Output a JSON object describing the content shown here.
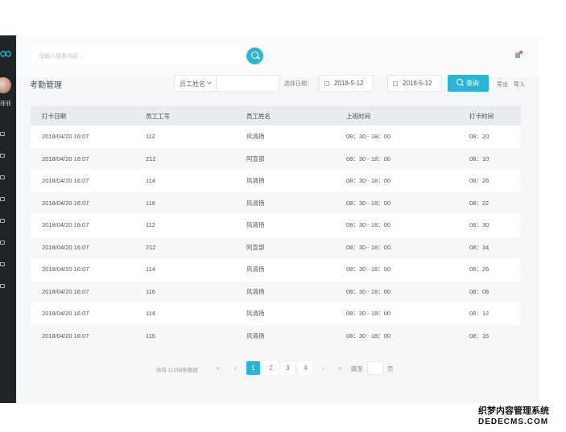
{
  "colors": {
    "accent": "#27b6d8",
    "sidebar": "#1f2428",
    "panel": "#f4f6f8"
  },
  "sidebar": {
    "logo_icon": "infinity-logo-icon",
    "user_name": "菲菲",
    "nav_icons": [
      "user-icon",
      "team-icon",
      "calendar-icon",
      "card-icon",
      "monitor-icon",
      "people-icon",
      "chart-icon",
      "file-icon"
    ]
  },
  "search": {
    "placeholder": "请输入搜索内容..."
  },
  "page": {
    "title": "考勤管理"
  },
  "filters": {
    "field_select": "员工姓名",
    "date_label": "选择日期：",
    "date_start": "2018-5-12",
    "date_end": "2018-5-12",
    "query_label": "查询",
    "export_label": "导出",
    "import_label": "导入"
  },
  "table": {
    "headers": [
      "打卡日期",
      "员工工号",
      "员工姓名",
      "上班时间",
      "打卡时间"
    ],
    "rows": [
      [
        "2018/04/20 16:07",
        "112",
        "风清扬",
        "08：30 - 18：00",
        "08：20"
      ],
      [
        "2018/04/20 16:07",
        "212",
        "阿宣部",
        "08：30 - 18：00",
        "08：10"
      ],
      [
        "2018/04/20 16:07",
        "114",
        "风清扬",
        "08：30 - 18：00",
        "08：26"
      ],
      [
        "2018/04/20 16:07",
        "116",
        "风清扬",
        "08：30 - 18：00",
        "08：22"
      ],
      [
        "2018/04/20 16:07",
        "112",
        "风清扬",
        "08：30 - 18：00",
        "08：30"
      ],
      [
        "2018/04/20 16:07",
        "212",
        "阿宣部",
        "08：30 - 18：00",
        "08：34"
      ],
      [
        "2018/04/20 16:07",
        "114",
        "风清扬",
        "08：30 - 18：00",
        "08：26"
      ],
      [
        "2018/04/20 16:07",
        "116",
        "风清扬",
        "08：30 - 18：00",
        "08：08"
      ],
      [
        "2018/04/20 16:07",
        "114",
        "风清扬",
        "08：30 - 18：00",
        "08：12"
      ],
      [
        "2018/04/20 16:07",
        "116",
        "风清扬",
        "08：30 - 18：00",
        "08：16"
      ]
    ]
  },
  "pagination": {
    "total_text": "共有 11258条数据",
    "first": "«",
    "prev": "‹",
    "pages": [
      "1",
      "2",
      "3",
      "4"
    ],
    "current": "1",
    "next": "›",
    "last": "»",
    "jump_label": "跳至",
    "page_unit": "页"
  },
  "watermark": {
    "line1": "织梦内容管理系统",
    "line2": "DEDECMS.COM"
  }
}
